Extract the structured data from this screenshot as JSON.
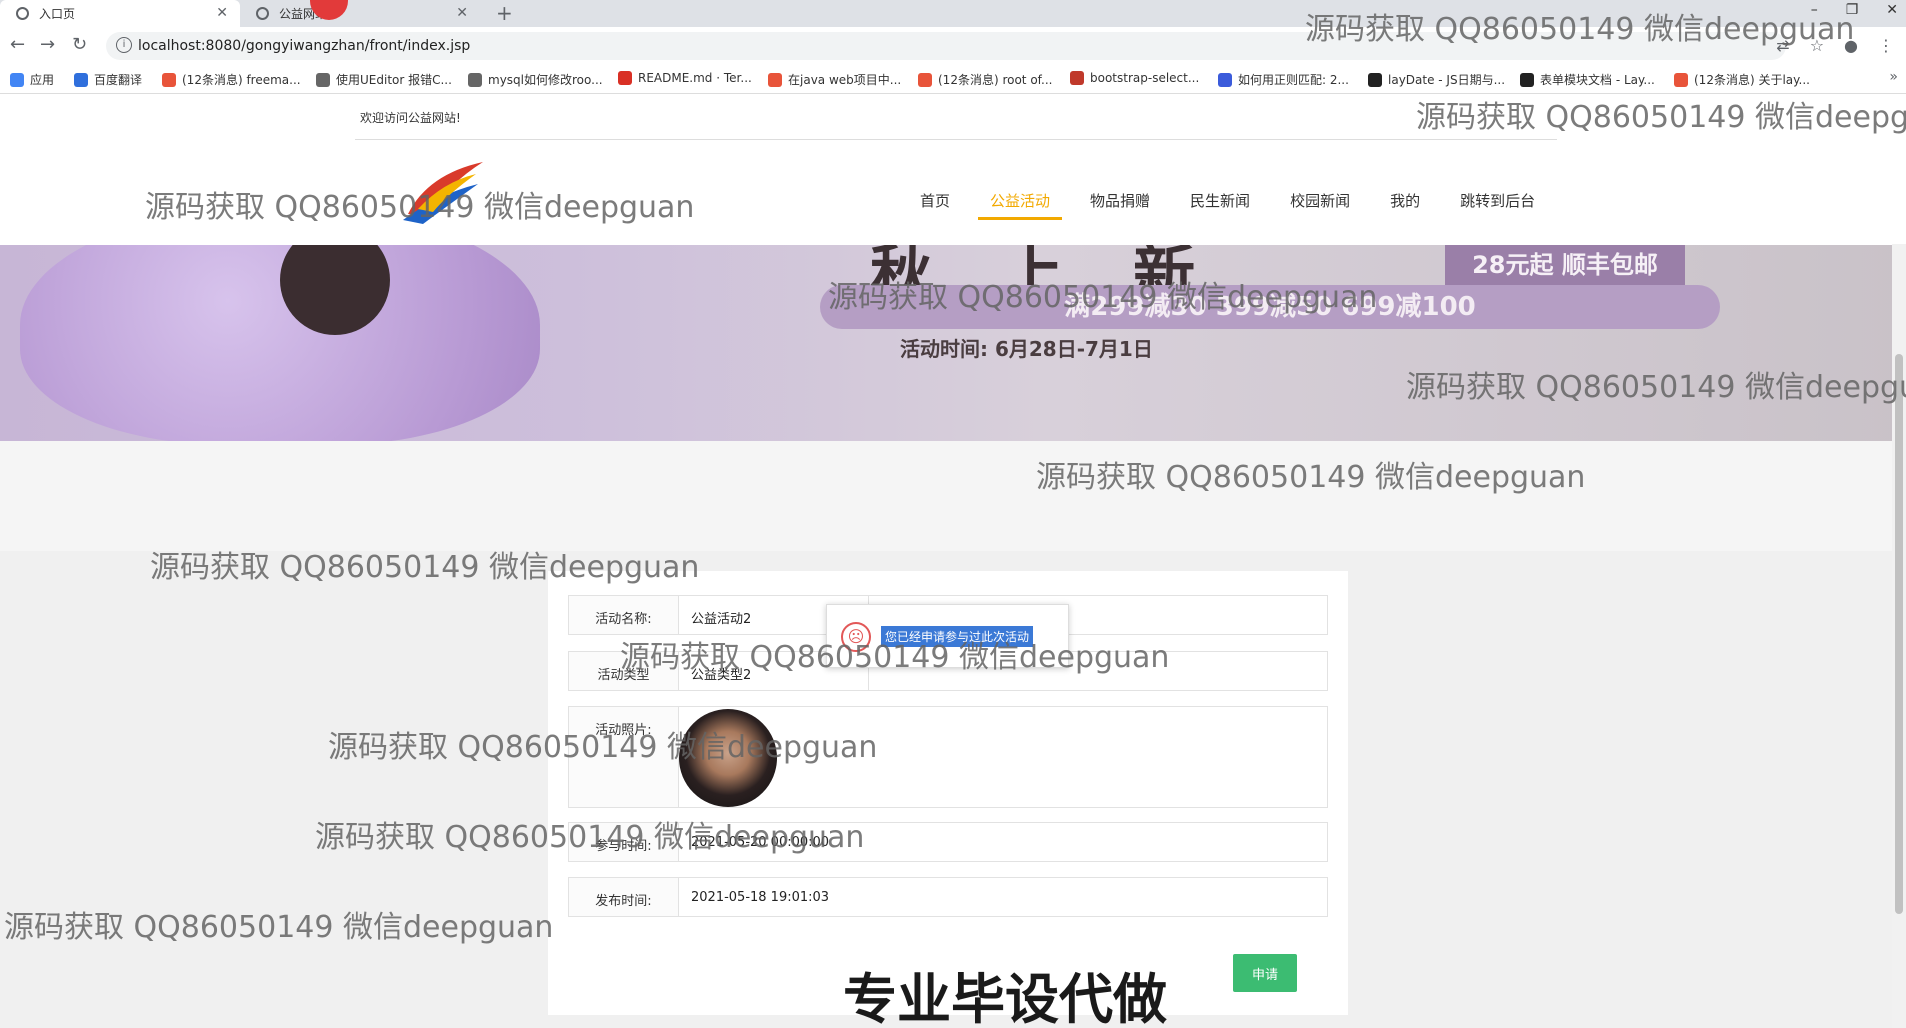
{
  "browser": {
    "tabs": [
      {
        "label": "入口页",
        "active": true
      },
      {
        "label": "公益网站",
        "active": false
      }
    ],
    "url": "localhost:8080/gongyiwangzhan/front/index.jsp",
    "bookmarks": [
      {
        "label": "应用",
        "color": "#4285f4"
      },
      {
        "label": "百度翻译",
        "color": "#2f6fdc"
      },
      {
        "label": "(12条消息) freema...",
        "color": "#e8543a"
      },
      {
        "label": "使用UEditor 报错C...",
        "color": "#666666"
      },
      {
        "label": "mysql如何修改roo...",
        "color": "#666666"
      },
      {
        "label": "README.md · Ter...",
        "color": "#d93025"
      },
      {
        "label": "在java web项目中...",
        "color": "#e8543a"
      },
      {
        "label": "(12条消息) root of...",
        "color": "#e8543a"
      },
      {
        "label": "bootstrap-select...",
        "color": "#c0392b"
      },
      {
        "label": "如何用正则匹配: 2...",
        "color": "#3b5bdb"
      },
      {
        "label": "layDate - JS日期与...",
        "color": "#222222"
      },
      {
        "label": "表单模块文档 - Lay...",
        "color": "#222222"
      },
      {
        "label": "(12条消息) 关于lay...",
        "color": "#e8543a"
      }
    ]
  },
  "site": {
    "welcome": "欢迎访问公益网站!",
    "nav": [
      {
        "label": "首页",
        "active": false
      },
      {
        "label": "公益活动",
        "active": true
      },
      {
        "label": "物品捐赠",
        "active": false
      },
      {
        "label": "民生新闻",
        "active": false
      },
      {
        "label": "校园新闻",
        "active": false
      },
      {
        "label": "我的",
        "active": false
      },
      {
        "label": "跳转到后台",
        "active": false
      }
    ],
    "banner": {
      "title": "秋 上 新",
      "promo_badge": "28元起 顺丰包邮",
      "promo": "满299减30  399减50  699减100",
      "time": "活动时间: 6月28日-7月1日"
    }
  },
  "detail": {
    "fields": [
      {
        "label": "活动名称:",
        "value": "公益活动2"
      },
      {
        "label": "活动类型",
        "value": "公益类型2"
      },
      {
        "label": "活动照片:",
        "value": ""
      },
      {
        "label": "参与时间:",
        "value": "2021-05-20 00:00:00"
      },
      {
        "label": "发布时间:",
        "value": "2021-05-18 19:01:03"
      }
    ],
    "apply_button": "申请"
  },
  "toast": {
    "icon": "sad-face-icon",
    "message": "您已经申请参与过此次活动"
  },
  "overlay_text": "专业毕设代做",
  "watermark": "源码获取 QQ86050149 微信deepguan",
  "colors": {
    "accent": "#f2a900",
    "button": "#3cbc72",
    "selection": "#3b79d6"
  }
}
